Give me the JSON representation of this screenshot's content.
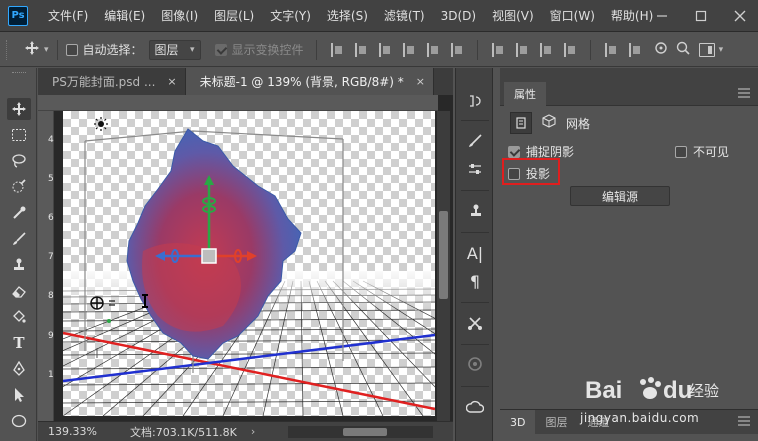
{
  "app": {
    "logo_text": "Ps"
  },
  "menubar": {
    "items": [
      "文件(F)",
      "编辑(E)",
      "图像(I)",
      "图层(L)",
      "文字(Y)",
      "选择(S)",
      "滤镜(T)",
      "3D(D)",
      "视图(V)",
      "窗口(W)",
      "帮助(H)"
    ],
    "window_buttons": [
      "minimize-icon",
      "maximize-icon",
      "close-icon"
    ]
  },
  "options_bar": {
    "tool_icon": "move-icon",
    "auto_select_label": "自动选择：",
    "auto_select_checked": false,
    "auto_select_value": "图层",
    "show_transform_label": "显示变换控件",
    "show_transform_checked": true,
    "show_transform_enabled": false
  },
  "tabs": [
    {
      "label": "PS万能封面.psd ...",
      "active": false,
      "close": "×"
    },
    {
      "label": "未标题-1 @ 139% (背景, RGB/8#) *",
      "active": true,
      "close": "×"
    }
  ],
  "rulers": {
    "vertical": [
      "4",
      "5",
      "6",
      "7",
      "8",
      "9",
      "1"
    ]
  },
  "statusbar": {
    "zoom": "139.33%",
    "doc_info": "文档:703.1K/511.8K",
    "arrow": "›"
  },
  "properties_panel": {
    "tab_label": "属性",
    "mesh_label": "网格",
    "catch_shadow": {
      "label": "捕捉阴影",
      "checked": true
    },
    "invisible": {
      "label": "不可见",
      "checked": false
    },
    "cast_shadow": {
      "label": "投影",
      "checked": false
    },
    "edit_source_button": "编辑源",
    "bottom_tabs": [
      "3D",
      "图层",
      "通道"
    ]
  },
  "watermark": {
    "brand": "Bai",
    "brand2": "du",
    "sub": "经验",
    "url": "jingyan.baidu.com"
  },
  "colors": {
    "highlight_box": "#e01e1e",
    "x_axis": "#e02020",
    "z_axis": "#2030d0",
    "y_axis": "#29a845",
    "panel_bg": "#535353",
    "bar_bg": "#424242",
    "ps_blue": "#31a8ff"
  }
}
